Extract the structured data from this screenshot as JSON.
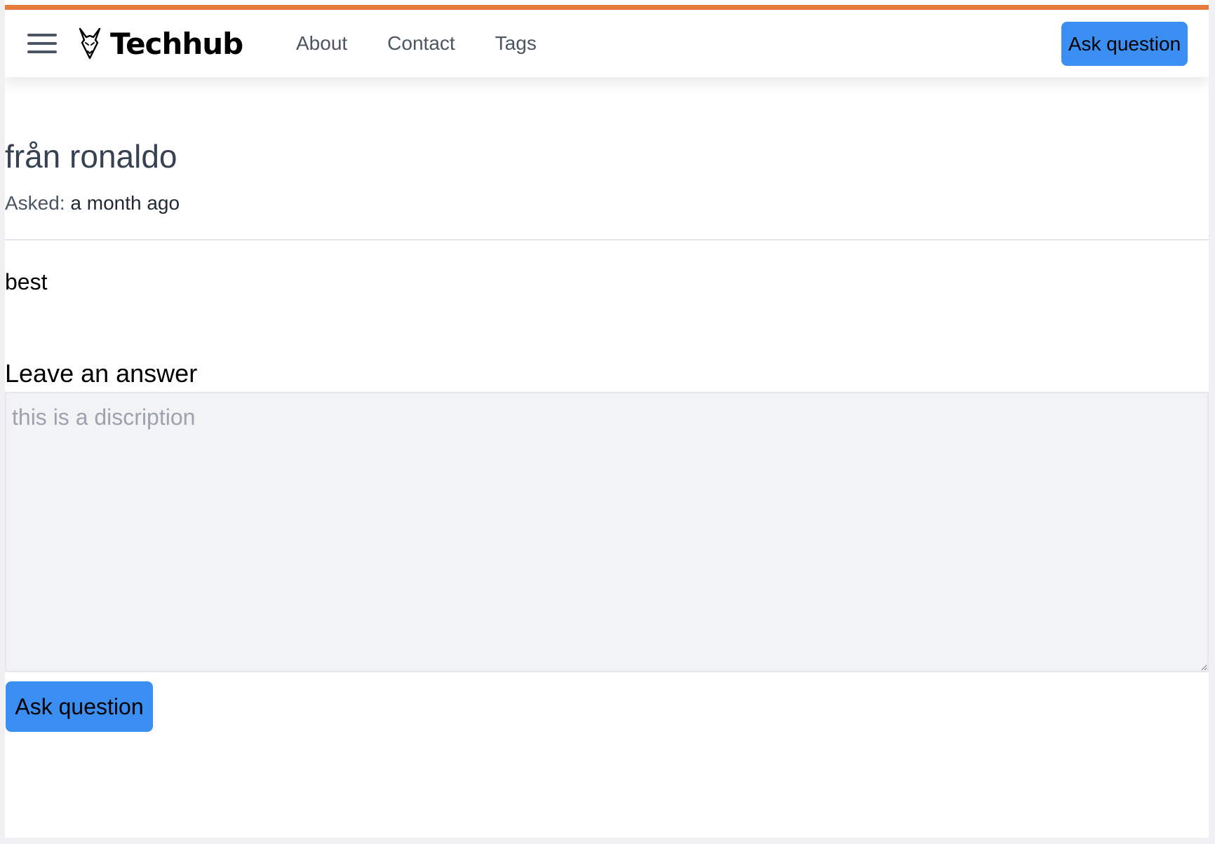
{
  "brand": {
    "name": "Techhub",
    "icon": "fox-head-icon"
  },
  "nav": {
    "menu_icon": "hamburger-menu-icon",
    "links": [
      {
        "label": "About"
      },
      {
        "label": "Contact"
      },
      {
        "label": "Tags"
      }
    ],
    "ask_button": "Ask question"
  },
  "question": {
    "title": "från ronaldo",
    "asked_label": "Asked:",
    "asked_value": "a month ago",
    "body": "best"
  },
  "answer_form": {
    "heading": "Leave an answer",
    "placeholder": "this is a discription",
    "value": "",
    "submit_label": "Ask question"
  },
  "colors": {
    "accent_bar": "#e67c3b",
    "primary_button": "#3b8ff3",
    "textarea_bg": "#f2f3f5"
  }
}
